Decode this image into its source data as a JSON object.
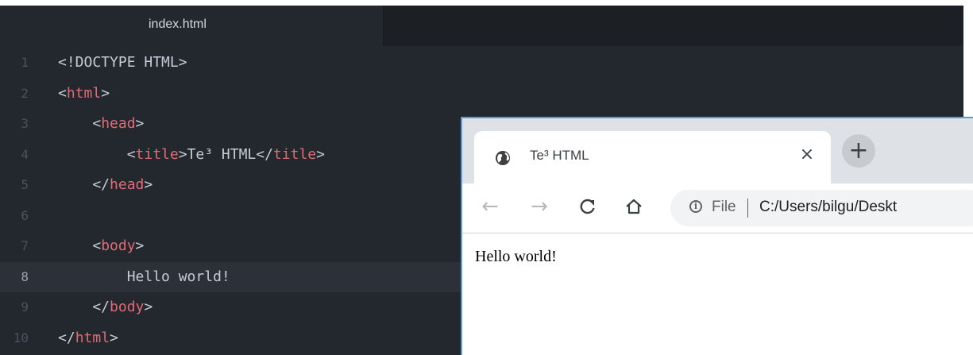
{
  "editor": {
    "tab_label": "index.html",
    "lines": [
      {
        "n": "1",
        "parts": [
          {
            "t": "<!DOCTYPE HTML>",
            "c": "punc"
          }
        ]
      },
      {
        "n": "2",
        "parts": [
          {
            "t": "<",
            "c": "punc"
          },
          {
            "t": "html",
            "c": "tag"
          },
          {
            "t": ">",
            "c": "punc"
          }
        ]
      },
      {
        "n": "3",
        "parts": [
          {
            "t": "    <",
            "c": "punc"
          },
          {
            "t": "head",
            "c": "tag"
          },
          {
            "t": ">",
            "c": "punc"
          }
        ]
      },
      {
        "n": "4",
        "parts": [
          {
            "t": "        <",
            "c": "punc"
          },
          {
            "t": "title",
            "c": "tag"
          },
          {
            "t": ">Te³ HTML</",
            "c": "punc"
          },
          {
            "t": "title",
            "c": "tag"
          },
          {
            "t": ">",
            "c": "punc"
          }
        ]
      },
      {
        "n": "5",
        "parts": [
          {
            "t": "    </",
            "c": "punc"
          },
          {
            "t": "head",
            "c": "tag"
          },
          {
            "t": ">",
            "c": "punc"
          }
        ]
      },
      {
        "n": "6",
        "parts": []
      },
      {
        "n": "7",
        "parts": [
          {
            "t": "    <",
            "c": "punc"
          },
          {
            "t": "body",
            "c": "tag"
          },
          {
            "t": ">",
            "c": "punc"
          }
        ]
      },
      {
        "n": "8",
        "active": true,
        "parts": [
          {
            "t": "        Hello world!",
            "c": "punc"
          }
        ]
      },
      {
        "n": "9",
        "parts": [
          {
            "t": "    </",
            "c": "punc"
          },
          {
            "t": "body",
            "c": "tag"
          },
          {
            "t": ">",
            "c": "punc"
          }
        ]
      },
      {
        "n": "10",
        "parts": [
          {
            "t": "</",
            "c": "punc"
          },
          {
            "t": "html",
            "c": "tag"
          },
          {
            "t": ">",
            "c": "punc"
          }
        ]
      }
    ]
  },
  "browser": {
    "tab_title": "Te³ HTML",
    "tab_icon": "globe-icon",
    "close_glyph": "×",
    "new_tab_glyph": "+",
    "nav": {
      "back": "←",
      "forward": "→",
      "reload": "C",
      "home": "⌂"
    },
    "address": {
      "scheme_label": "File",
      "url": "C:/Users/bilgu/Deskt"
    },
    "page_text": "Hello world!"
  },
  "colors": {
    "editor_bg": "#23272e",
    "tag": "#e06c75",
    "text": "#c5ccd6",
    "browser_frame": "#5b9bd5"
  }
}
